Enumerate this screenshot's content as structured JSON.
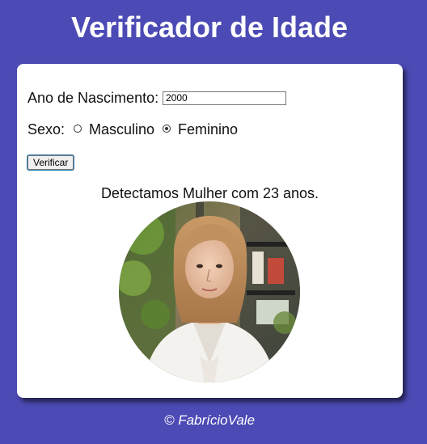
{
  "header": {
    "title": "Verificador de Idade"
  },
  "form": {
    "birth_year_label": "Ano de Nascimento:",
    "birth_year_value": "2000",
    "sex_label": "Sexo:",
    "sex_options": [
      {
        "label": "Masculino",
        "checked": false
      },
      {
        "label": "Feminino",
        "checked": true
      }
    ],
    "verify_button_label": "Verificar"
  },
  "result": {
    "message": "Detectamos Mulher com 23 anos.",
    "photo_icon": "woman-portrait-photo"
  },
  "footer": {
    "credit": "© FabrícioVale"
  },
  "colors": {
    "page_background": "#4c4ab4",
    "card_background": "#ffffff",
    "title_color": "#ffffff"
  }
}
